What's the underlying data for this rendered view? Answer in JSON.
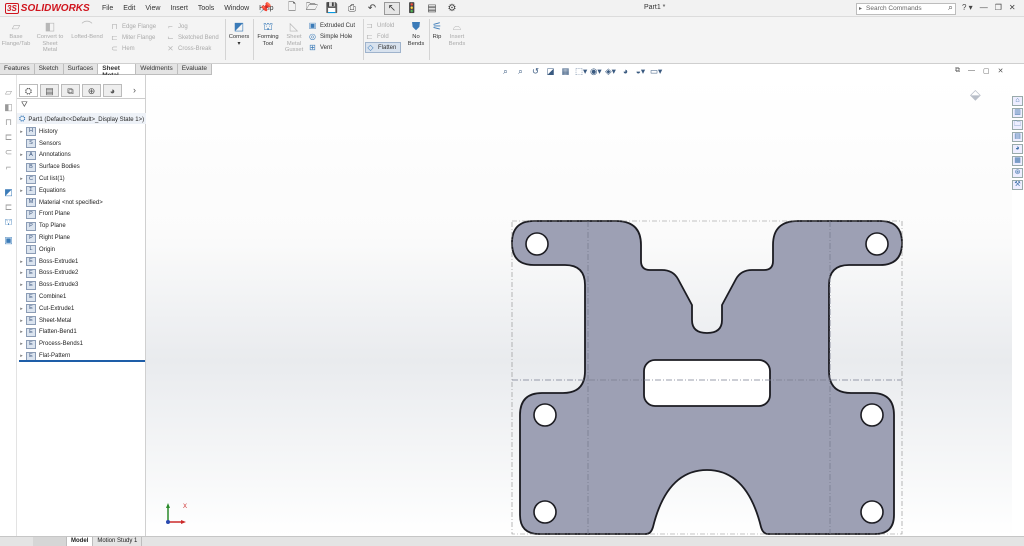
{
  "app": {
    "brand_prefix": "3S",
    "brand": "SOLIDWORKS",
    "doc_title": "Part1 *"
  },
  "menu": [
    "File",
    "Edit",
    "View",
    "Insert",
    "Tools",
    "Window",
    "Help"
  ],
  "search": {
    "placeholder": "Search Commands"
  },
  "ribbon": {
    "base_flange": "Base Flange/Tab",
    "convert": "Convert to Sheet Metal",
    "lofted_bend": "Lofted-Bend",
    "edge_flange": "Edge Flange",
    "jog": "Jog",
    "miter_flange": "Miter Flange",
    "sketched_bend": "Sketched Bend",
    "hem": "Hem",
    "cross_break": "Cross-Break",
    "corners": "Corners",
    "forming_tool": "Forming Tool",
    "gusset": "Sheet Metal Gusset",
    "extruded_cut": "Extruded Cut",
    "simple_hole": "Simple Hole",
    "vent": "Vent",
    "unfold": "Unfold",
    "fold": "Fold",
    "flatten": "Flatten",
    "no_bends": "No Bends",
    "rip": "Rip",
    "insert_bends": "Insert Bends"
  },
  "cm_tabs": [
    "Features",
    "Sketch",
    "Surfaces",
    "Sheet Metal",
    "Weldments",
    "Evaluate"
  ],
  "cm_active": "Sheet Metal",
  "feature_tree": {
    "root": "Part1  (Default<<Default>_Display State 1>)",
    "nodes": [
      {
        "label": "History",
        "expand": "▸",
        "icon": "H"
      },
      {
        "label": "Sensors",
        "expand": "",
        "icon": "S"
      },
      {
        "label": "Annotations",
        "expand": "▸",
        "icon": "A"
      },
      {
        "label": "Surface Bodies",
        "expand": "",
        "icon": "B"
      },
      {
        "label": "Cut list(1)",
        "expand": "▸",
        "icon": "C"
      },
      {
        "label": "Equations",
        "expand": "▸",
        "icon": "Σ"
      },
      {
        "label": "Material <not specified>",
        "expand": "",
        "icon": "M"
      },
      {
        "label": "Front Plane",
        "expand": "",
        "icon": "P"
      },
      {
        "label": "Top Plane",
        "expand": "",
        "icon": "P"
      },
      {
        "label": "Right Plane",
        "expand": "",
        "icon": "P"
      },
      {
        "label": "Origin",
        "expand": "",
        "icon": "L"
      },
      {
        "label": "Boss-Extrude1",
        "expand": "▸",
        "icon": "E"
      },
      {
        "label": "Boss-Extrude2",
        "expand": "▸",
        "icon": "E"
      },
      {
        "label": "Boss-Extrude3",
        "expand": "▸",
        "icon": "E"
      },
      {
        "label": "Combine1",
        "expand": "",
        "icon": "E"
      },
      {
        "label": "Cut-Extrude1",
        "expand": "▸",
        "icon": "E"
      },
      {
        "label": "Sheet-Metal",
        "expand": "▸",
        "icon": "E"
      },
      {
        "label": "Flatten-Bend1",
        "expand": "▸",
        "icon": "E"
      },
      {
        "label": "Process-Bends1",
        "expand": "▸",
        "icon": "E"
      },
      {
        "label": "Flat-Pattern",
        "expand": "▸",
        "icon": "E"
      }
    ]
  },
  "bottom_tabs": [
    "Model",
    "Motion Study 1"
  ],
  "triad": {
    "x_label": "X"
  },
  "colors": {
    "part_fill": "#9da0b4",
    "part_edge": "#1c1c22",
    "accent": "#3b7bb8",
    "brand": "#d0141d"
  }
}
